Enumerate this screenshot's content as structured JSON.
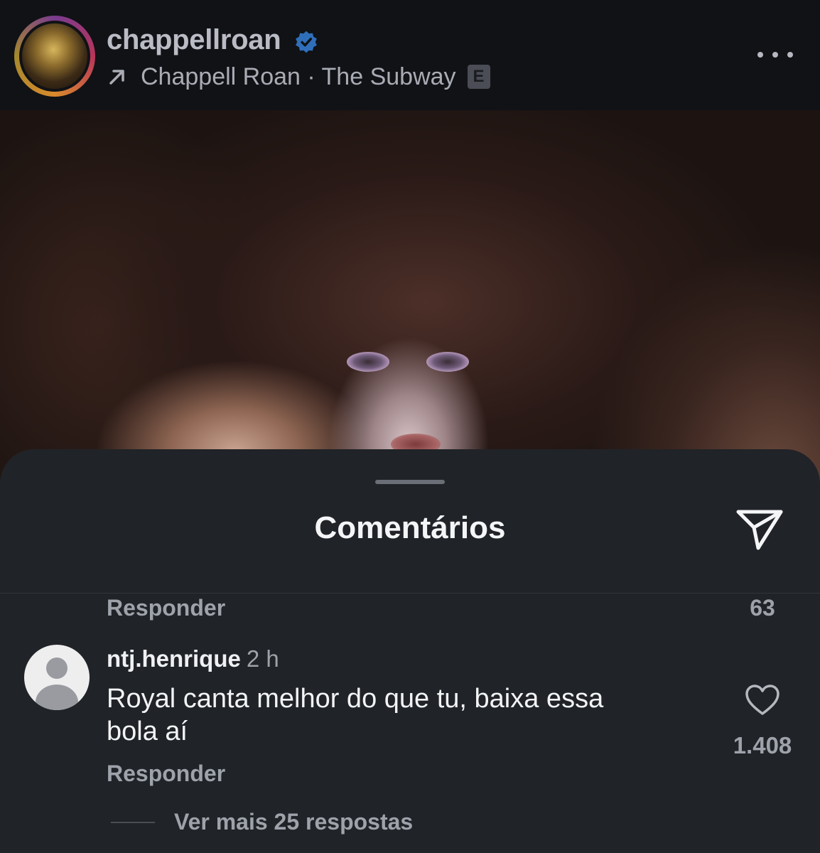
{
  "post_header": {
    "username": "chappellroan",
    "verified_icon": "verified-badge-icon",
    "music_arrow_icon": "arrow-up-right-icon",
    "music": "Chappell Roan · The Subway",
    "explicit_badge": "E",
    "more_icon": "more-options-icon"
  },
  "comments_sheet": {
    "title": "Comentários",
    "share_icon": "send-icon",
    "previous_comment": {
      "reply_label": "Responder",
      "like_count": "63"
    },
    "comment": {
      "username": "ntj.henrique",
      "time": "2 h",
      "text": "Royal canta melhor do que tu, baixa essa bola aí",
      "like_icon": "heart-icon",
      "like_count": "1.408",
      "reply_label": "Responder",
      "view_more_replies": "Ver mais 25 respostas"
    }
  },
  "colors": {
    "sheet_background": "#202327",
    "header_background": "#101216",
    "verified_blue": "#3897f0"
  }
}
